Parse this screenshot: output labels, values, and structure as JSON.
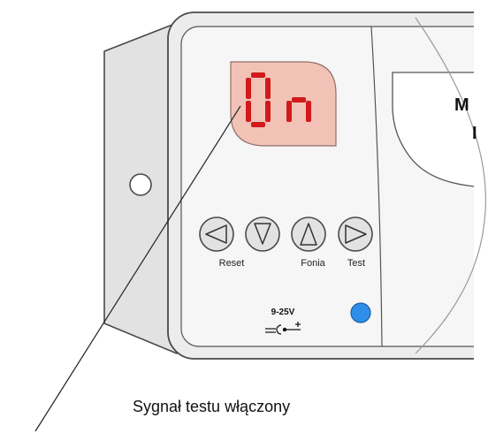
{
  "display": {
    "text": "On"
  },
  "buttons": [
    {
      "name": "left-arrow-button",
      "icon": "triangle-left-icon",
      "label": "Reset"
    },
    {
      "name": "down-arrow-button",
      "icon": "triangle-down-icon",
      "label": ""
    },
    {
      "name": "up-arrow-button",
      "icon": "triangle-up-icon",
      "label": "Fonia"
    },
    {
      "name": "right-arrow-button",
      "icon": "triangle-right-icon",
      "label": "Test"
    }
  ],
  "power": {
    "voltage": "9-25V",
    "icon": "dc-power-polarity-icon"
  },
  "status_led": {
    "icon": "blue-led-icon",
    "color": "#2f8fe8"
  },
  "cut_off_label": {
    "line1": "M",
    "line2": "I"
  },
  "caption": "Sygnał testu włączony",
  "colors": {
    "display_bg": "#f3c2b7",
    "segment": "#d11a1a",
    "housing": "#ededed",
    "outline": "#4a4a4a"
  }
}
